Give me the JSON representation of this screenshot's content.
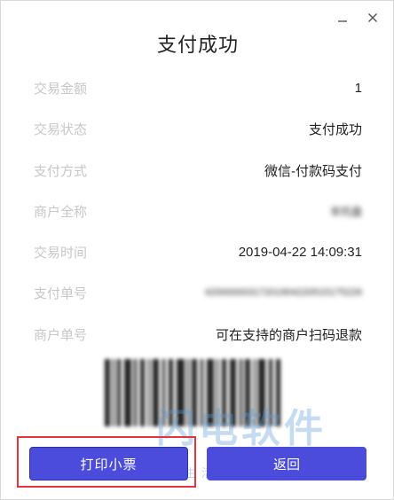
{
  "dialog": {
    "title": "支付成功"
  },
  "window_controls": {
    "minimize_icon": "minimize-icon",
    "close_icon": "close-icon"
  },
  "fields": [
    {
      "label": "交易金额",
      "value": "1"
    },
    {
      "label": "交易状态",
      "value": "支付成功"
    },
    {
      "label": "支付方式",
      "value": "微信-付款码支付"
    },
    {
      "label": "商户全称",
      "value": "羊托盘"
    },
    {
      "label": "交易时间",
      "value": "2019-04-22 14:09:31"
    },
    {
      "label": "支付单号",
      "value": "42000000317201904220515175226"
    },
    {
      "label": "商户单号",
      "value": "可在支持的商户扫码退款"
    }
  ],
  "watermark": {
    "main": "闪电软件",
    "sub": "快乐生活从我们开始"
  },
  "buttons": {
    "print": "打印小票",
    "back": "返回"
  },
  "colors": {
    "primary": "#4b4bdc",
    "highlight": "#e3353d",
    "label": "#c7c7c7"
  }
}
